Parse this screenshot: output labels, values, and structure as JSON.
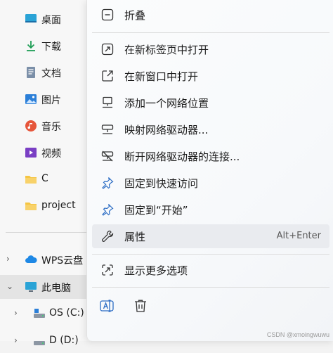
{
  "nav": {
    "quick_access": [
      {
        "label": "桌面",
        "icon": "desktop-icon"
      },
      {
        "label": "下载",
        "icon": "download-icon"
      },
      {
        "label": "文档",
        "icon": "document-icon"
      },
      {
        "label": "图片",
        "icon": "pictures-icon"
      },
      {
        "label": "音乐",
        "icon": "music-icon"
      },
      {
        "label": "视频",
        "icon": "video-icon"
      },
      {
        "label": "C",
        "icon": "folder-icon"
      },
      {
        "label": "project",
        "icon": "folder-icon"
      }
    ],
    "tree": [
      {
        "label": "WPS云盘",
        "icon": "cloud-icon",
        "expanded": false
      },
      {
        "label": "此电脑",
        "icon": "computer-icon",
        "expanded": true,
        "selected": true
      },
      {
        "label": "OS (C:)",
        "icon": "drive-icon",
        "expanded": false
      },
      {
        "label": "D (D:)",
        "icon": "drive-icon",
        "expanded": false
      }
    ]
  },
  "menu": {
    "collapse": "折叠",
    "open_new_tab": "在新标签页中打开",
    "open_new_window": "在新窗口中打开",
    "add_network_location": "添加一个网络位置",
    "map_network_drive": "映射网络驱动器...",
    "disconnect_network_drive": "断开网络驱动器的连接...",
    "pin_quick_access": "固定到快速访问",
    "pin_start": "固定到“开始”",
    "properties": "属性",
    "properties_shortcut": "Alt+Enter",
    "show_more_options": "显示更多选项"
  },
  "watermark": "CSDN @xmoingwuwu",
  "colors": {
    "accent": "#0067c0",
    "folder": "#f5c542"
  }
}
